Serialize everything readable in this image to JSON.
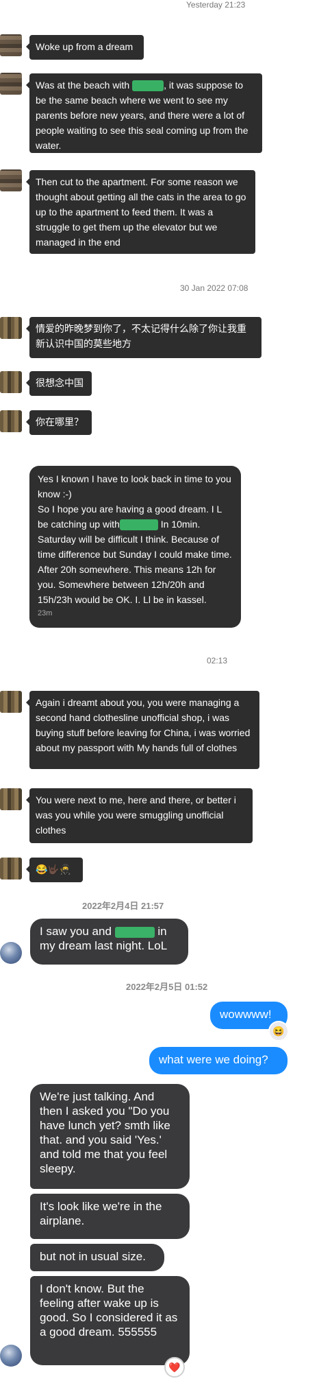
{
  "timestamps": {
    "t1": "Yesterday 21:23",
    "t2": "30 Jan 2022 07:08",
    "t3": "02:13",
    "t4": "2022年2月4日 21:57",
    "t5": "2022年2月5日 01:52"
  },
  "wechat": {
    "m1": "Woke up from a dream",
    "m2_a": "Was at the beach with",
    "m2_b": ", it was suppose to be the same beach where we went to see my parents before new years, and there were a lot of people waiting to see this seal coming up from the water.",
    "m3": "Then cut to the apartment. For some reason we thought about getting all the cats in the area to go up to the apartment to feed them. It was a struggle to get them up the elevator but we managed in the end",
    "m4": "情爱的昨晚梦到你了，不太记得什么除了你让我重新认识中国的莫些地方",
    "m5": "很想念中国",
    "m6": "你在哪里？",
    "m7_a": "Yes I known I have to look back in time to you know :-)\nSo I hope you are having a good dream. I L be catching up with",
    "m7_b": " In 10min. Saturday will be difficult I think. Because of time difference but Sunday I could make time. After 20h somewhere. This means 12h for you. Somewhere between 12h/20h and 15h/23h  would be OK. I. Ll be in kassel.",
    "m7_meta": "23m",
    "m8": "Again i dreamt about you, you were managing a second hand clothesline unofficial shop, i was buying stuff before leaving for China, i was worried about my passport with My hands full of clothes",
    "m9": "You were next to me, here and there, or better i was you while you were smuggling unofficial clothes",
    "m10": "😂🤟🏿🥷"
  },
  "imessage": {
    "i1_a": "I saw you and",
    "i1_b": "in my dream last night. LoL",
    "o1": "wowwww!",
    "o1_tapback": "😆",
    "o2": "what were we doing?",
    "i2": "We're just talking. And then I asked you \"Do you have lunch yet? smth like that. and you said 'Yes.' and told me that you feel sleepy.",
    "i3": "It's look like we're in the airplane.",
    "i4": "but not in usual size.",
    "i5": "I don't know. But the feeling after wake up is good. So I considered it as a good dream. 555555",
    "i5_tapback": "❤️"
  },
  "colors": {
    "wechat_bubble": "#2d2d2d",
    "imessage_incoming": "#3a3a3c",
    "imessage_outgoing": "#1a8cff",
    "redaction": "#3bc06b"
  }
}
